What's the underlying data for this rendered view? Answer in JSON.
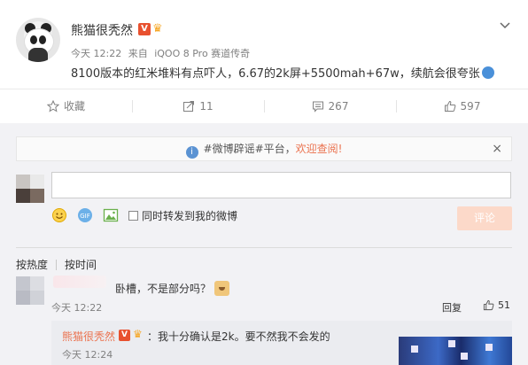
{
  "post": {
    "username": "熊猫很秃然",
    "verified_badge": "V",
    "time": "今天 12:22",
    "source_prefix": "来自",
    "source_device": "iQOO 8 Pro 赛道传奇",
    "content": "8100版本的红米堆料有点吓人，6.67的2k屏+5500mah+67w，续航会很夸张"
  },
  "actions": {
    "favorite": "收藏",
    "forward_count": "11",
    "comment_count": "267",
    "like_count": "597"
  },
  "notice": {
    "text": "#微博辟谣#平台，",
    "link": "欢迎查阅!",
    "close": "×"
  },
  "composer": {
    "input_value": "",
    "forward_label": "同时转发到我的微博",
    "submit_label": "评论"
  },
  "sort": {
    "hot": "按热度",
    "time": "按时间"
  },
  "comments": [
    {
      "text": "卧槽，不是部分吗？",
      "time": "今天 12:22",
      "reply_label": "回复",
      "likes": "51"
    }
  ],
  "reply": {
    "username": "熊猫很秃然",
    "verified_badge": "V",
    "text": "：我十分确认是2k。要不然我不会发的",
    "time": "今天 12:24"
  },
  "colors": {
    "accent_orange": "#eb7350",
    "badge_red": "#e8512f",
    "comment_bg": "#f2f2f5",
    "disabled_button": "#fcd9c9"
  }
}
